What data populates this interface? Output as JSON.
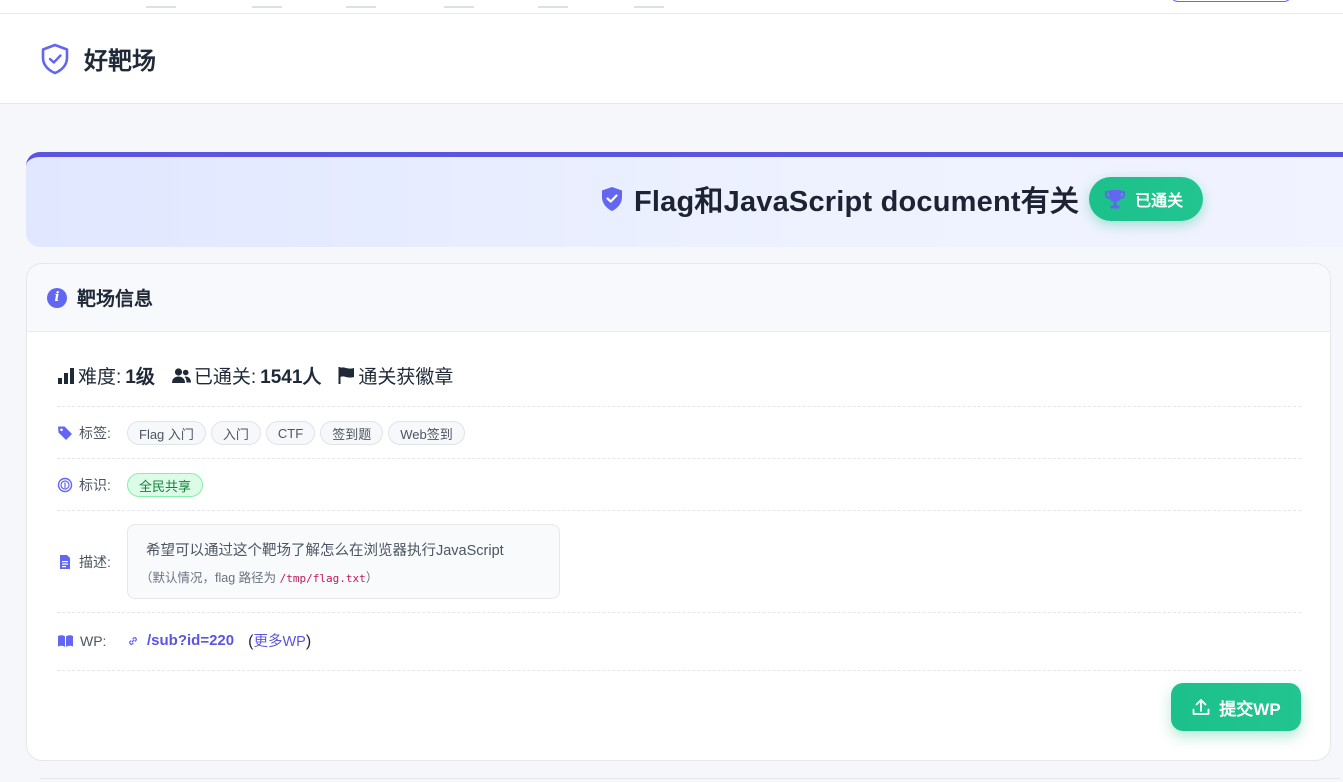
{
  "header": {
    "site_name": "好靶场"
  },
  "banner": {
    "title": "Flag和JavaScript document有关",
    "badge": "已通关"
  },
  "card": {
    "title": "靶场信息",
    "stats": {
      "difficulty_label": "难度:",
      "difficulty_value": "1级",
      "passed_label": "已通关:",
      "passed_value": "1541人",
      "badge_text": "通关获徽章"
    },
    "tags": {
      "label": "标签:",
      "items": [
        "Flag 入门",
        "入门",
        "CTF",
        "签到题",
        "Web签到"
      ]
    },
    "marks": {
      "label": "标识:",
      "items": [
        "全民共享"
      ]
    },
    "description": {
      "label": "描述:",
      "main": "希望可以通过这个靶场了解怎么在浏览器执行JavaScript",
      "sub_prefix": "（默认情况，flag 路径为 ",
      "path": "/tmp/flag.txt",
      "sub_suffix": "）"
    },
    "wp": {
      "label": "WP:",
      "link": "/sub?id=220",
      "more_open": "(",
      "more": "更多WP",
      "more_close": ")"
    },
    "submit": "提交WP"
  },
  "colors": {
    "accent": "#5b55e0",
    "success": "#1cc08a",
    "icon": "#6366f1"
  }
}
